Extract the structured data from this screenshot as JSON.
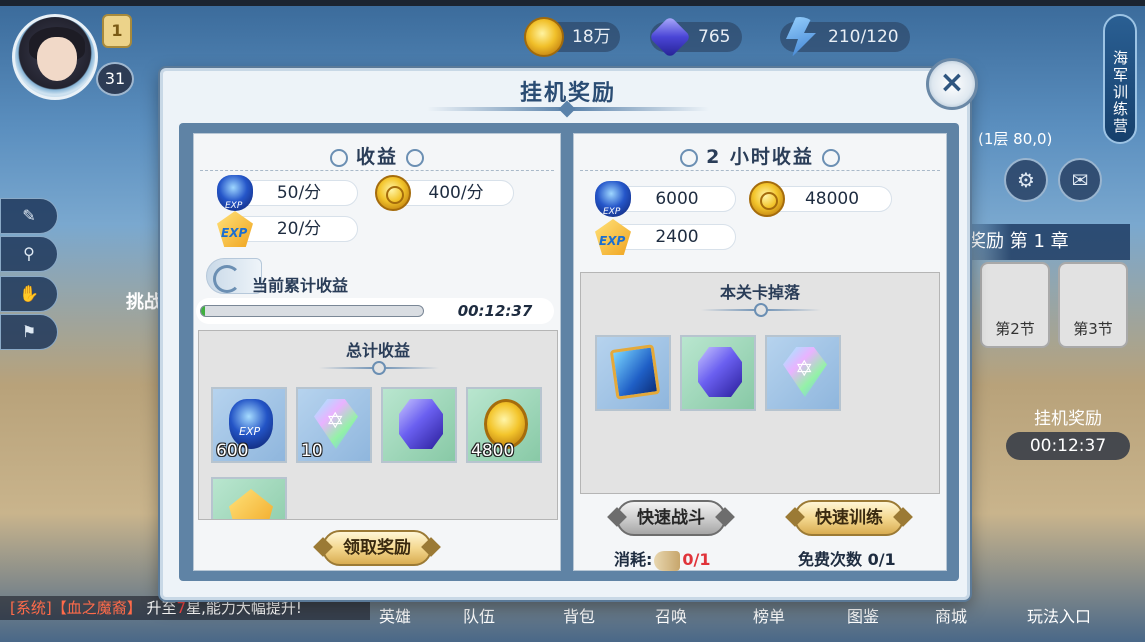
{
  "hud": {
    "rank": "1",
    "level": "31",
    "resources": [
      {
        "icon": "gold-coin-icon",
        "value": "18万"
      },
      {
        "icon": "gem-icon",
        "value": "765"
      },
      {
        "icon": "energy-icon",
        "value": "210/120"
      }
    ],
    "side_title": "海军训练营",
    "floor": "(1层 80,0)",
    "chapter": "奖励 第 1 章",
    "sections": [
      "第2节",
      "第3节"
    ],
    "idle_label": "挂机奖励",
    "idle_time": "00:12:37",
    "left_challenge": "挑战",
    "chat_sys": "[系统]",
    "chat_name": "【血之魔裔】",
    "chat_text_a": "升至",
    "chat_star": "7",
    "chat_text_b": "星,能力大幅提升!",
    "bottom_tabs": [
      "英雄",
      "队伍",
      "背包",
      "召唤",
      "榜单",
      "图鉴",
      "商城",
      "玩法入口"
    ]
  },
  "dialog": {
    "title": "挂机奖励",
    "close_icon": "close-icon",
    "left": {
      "header": "收益",
      "rates": [
        {
          "icon": "exp-gem-icon",
          "value": "50/分"
        },
        {
          "icon": "gold-coin-icon",
          "value": "400/分"
        },
        {
          "icon": "exp-badge-icon",
          "value": "20/分"
        }
      ],
      "current_label": "当前累计收益",
      "progress": 0.02,
      "elapsed": "00:12:37",
      "total_header": "总计收益",
      "items": [
        {
          "icon": "exp-gem-icon",
          "count": "600",
          "bg": "blue"
        },
        {
          "icon": "star-crystal-icon",
          "count": "10",
          "bg": "blue"
        },
        {
          "icon": "purple-gem-icon",
          "count": "",
          "bg": "green"
        },
        {
          "icon": "gold-coin-icon",
          "count": "4800",
          "bg": "green"
        },
        {
          "icon": "exp-badge-icon",
          "count": "",
          "bg": "green"
        }
      ],
      "claim_button": "领取奖励"
    },
    "right": {
      "header": "2 小时收益",
      "rates": [
        {
          "icon": "exp-gem-icon",
          "value": "6000"
        },
        {
          "icon": "gold-coin-icon",
          "value": "48000"
        },
        {
          "icon": "exp-badge-icon",
          "value": "2400"
        }
      ],
      "drops_header": "本关卡掉落",
      "drops": [
        {
          "icon": "skill-book-icon",
          "bg": "blue"
        },
        {
          "icon": "purple-gem-icon",
          "bg": "green"
        },
        {
          "icon": "star-crystal-icon",
          "bg": "blue"
        }
      ],
      "quick_battle": "快速战斗",
      "quick_train": "快速训练",
      "cost_label": "消耗:",
      "cost_value": "0/1",
      "free_label": "免费次数 0/1"
    }
  }
}
